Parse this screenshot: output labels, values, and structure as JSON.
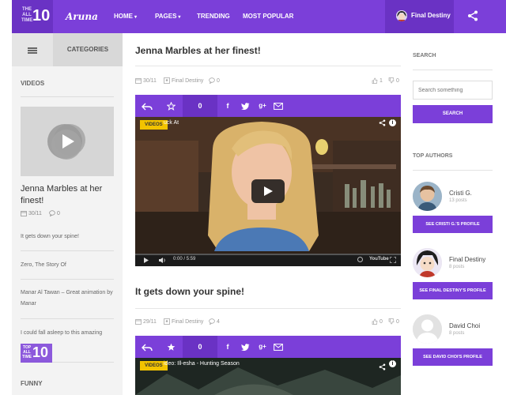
{
  "logo": {
    "small_text": [
      "THE",
      "ALL",
      "TIME"
    ],
    "number": "10",
    "brand": "Aruna"
  },
  "nav": {
    "items": [
      {
        "label": "HOME",
        "dropdown": true
      },
      {
        "label": "PAGES",
        "dropdown": true
      },
      {
        "label": "TRENDING",
        "dropdown": false
      },
      {
        "label": "MOST POPULAR",
        "dropdown": false
      }
    ]
  },
  "user": {
    "name": "Final Destiny"
  },
  "left_sidebar": {
    "categories_label": "CATEGORIES",
    "videos_heading": "VIDEOS",
    "featured": {
      "title": "Jenna Marbles at her finest!",
      "date": "30/11",
      "comments": "0"
    },
    "items": [
      "It gets down your spine!",
      "Zero, The Story Of",
      "Manar Al Tawan – Great animation by Manar",
      "I could fall asleep to this amazing"
    ],
    "funny_heading": "FUNNY",
    "watermark": {
      "small_text": [
        "TOP",
        "ALL",
        "TIME"
      ],
      "number": "10"
    }
  },
  "posts": [
    {
      "title": "Jenna Marbles at her finest!",
      "date": "30/11",
      "author": "Final Destiny",
      "comments": "0",
      "likes": "1",
      "dislikes": "0",
      "bar_count": "0",
      "video": {
        "badge": "VIDEOS",
        "title": "uck At",
        "time": "0:00 / 5:59"
      }
    },
    {
      "title": "It gets down your spine!",
      "date": "29/11",
      "author": "Final Destiny",
      "comments": "4",
      "likes": "0",
      "dislikes": "0",
      "bar_count": "0",
      "video": {
        "badge": "VIDEOS",
        "title": "ideo: Ill-esha - Hunting Season",
        "time": ""
      }
    }
  ],
  "right_sidebar": {
    "search_heading": "SEARCH",
    "search_placeholder": "Search something",
    "search_button": "SEARCH",
    "authors_heading": "TOP AUTHORS",
    "authors": [
      {
        "name": "Cristi G.",
        "posts": "13 posts",
        "button": "SEE CRISTI G.'S PROFILE"
      },
      {
        "name": "Final Destiny",
        "posts": "8 posts",
        "button": "SEE FINAL DESTINY'S PROFILE"
      },
      {
        "name": "David Choi",
        "posts": "8 posts",
        "button": "SEE DAVID CHOI'S PROFILE"
      }
    ]
  },
  "colors": {
    "accent": "#7b3fd9",
    "accent_dark": "#6a32c4",
    "badge": "#f2c300"
  }
}
